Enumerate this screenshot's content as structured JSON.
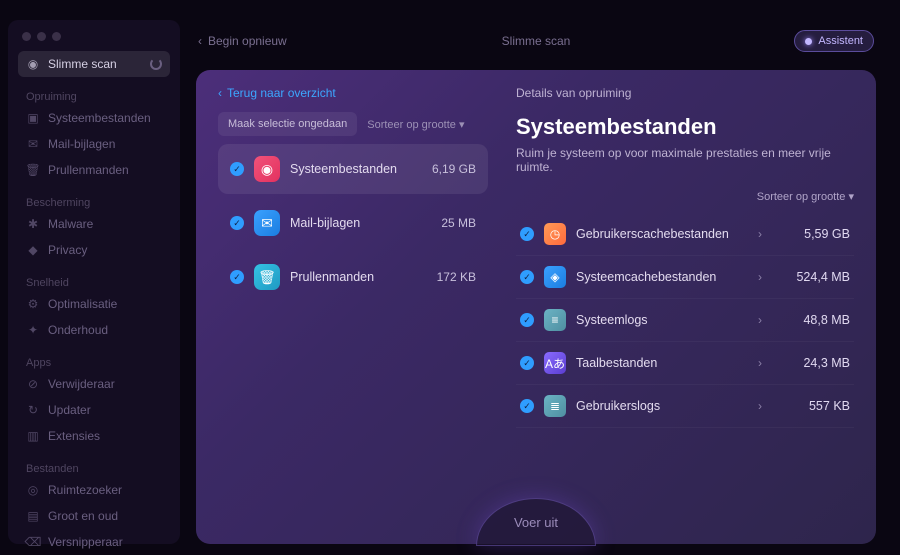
{
  "topbar": {
    "back": "Begin opnieuw",
    "title": "Slimme scan",
    "assistant": "Assistent"
  },
  "sidebar": {
    "smart_scan": "Slimme scan",
    "sections": {
      "cleanup": "Opruiming",
      "protection": "Bescherming",
      "speed": "Snelheid",
      "apps": "Apps",
      "files": "Bestanden"
    },
    "items": {
      "system": "Systeembestanden",
      "mail": "Mail-bijlagen",
      "trash": "Prullenmanden",
      "malware": "Malware",
      "privacy": "Privacy",
      "optim": "Optimalisatie",
      "maint": "Onderhoud",
      "uninst": "Verwijderaar",
      "updater": "Updater",
      "ext": "Extensies",
      "space": "Ruimtezoeker",
      "large": "Groot en oud",
      "shred": "Versnipperaar"
    }
  },
  "left": {
    "overview_link": "Terug naar overzicht",
    "deselect": "Maak selectie ongedaan",
    "sort": "Sorteer op grootte ▾",
    "cats": [
      {
        "name": "Systeembestanden",
        "size": "6,19 GB"
      },
      {
        "name": "Mail-bijlagen",
        "size": "25 MB"
      },
      {
        "name": "Prullenmanden",
        "size": "172 KB"
      }
    ]
  },
  "detail": {
    "header": "Details van opruiming",
    "title": "Systeembestanden",
    "sub": "Ruim je systeem op voor maximale prestaties en meer vrije ruimte.",
    "sort": "Sorteer op grootte ▾",
    "items": [
      {
        "name": "Gebruikerscachebestanden",
        "size": "5,59 GB"
      },
      {
        "name": "Systeemcachebestanden",
        "size": "524,4 MB"
      },
      {
        "name": "Systeemlogs",
        "size": "48,8 MB"
      },
      {
        "name": "Taalbestanden",
        "size": "24,3 MB"
      },
      {
        "name": "Gebruikerslogs",
        "size": "557 KB"
      }
    ]
  },
  "run_button": "Voer uit"
}
